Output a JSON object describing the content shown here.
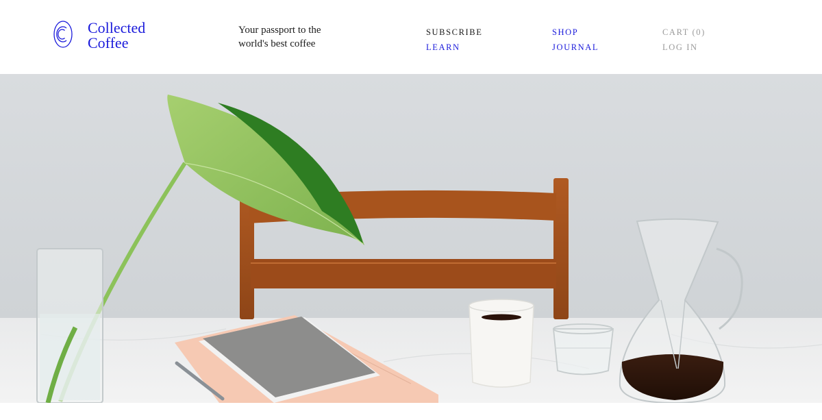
{
  "brand": {
    "line1": "Collected",
    "line2": "Coffee",
    "color": "#1a1adb"
  },
  "tagline": {
    "line1": "Your passport to the",
    "line2": "world's best coffee"
  },
  "nav": {
    "subscribe": "SUBSCRIBE",
    "learn": "LEARN",
    "shop": "SHOP",
    "journal": "JOURNAL",
    "cart": "CART (0)",
    "login": "LOG IN"
  },
  "colors": {
    "accent": "#1a1adb",
    "text": "#1b1b1b",
    "muted": "#9a9a9a"
  },
  "hero": {
    "icon": "hero-photo"
  }
}
